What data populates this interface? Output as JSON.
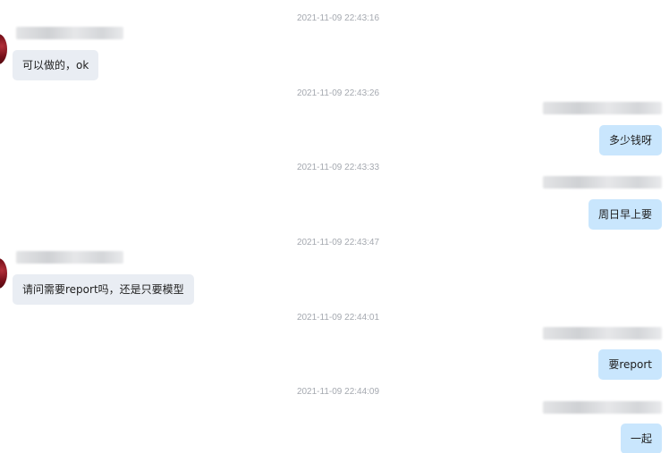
{
  "conversation": {
    "messages": [
      {
        "direction": "in",
        "timestamp": "2021-11-09 22:43:16",
        "text": "可以做的，ok"
      },
      {
        "direction": "out",
        "timestamp": "2021-11-09 22:43:26",
        "text": "多少钱呀"
      },
      {
        "direction": "out",
        "timestamp": "2021-11-09 22:43:33",
        "text": "周日早上要"
      },
      {
        "direction": "in",
        "timestamp": "2021-11-09 22:43:47",
        "text": "请问需要report吗，还是只要模型"
      },
      {
        "direction": "out",
        "timestamp": "2021-11-09 22:44:01",
        "text": "要report"
      },
      {
        "direction": "out",
        "timestamp": "2021-11-09 22:44:09",
        "text": "一起"
      }
    ]
  },
  "colors": {
    "incoming_bubble": "#e9edf3",
    "outgoing_bubble": "#c9e6fd",
    "timestamp_text": "#a5a9b0",
    "avatar": "#7a111b"
  }
}
